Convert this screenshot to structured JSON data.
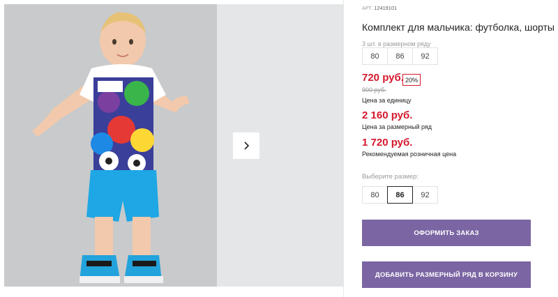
{
  "gallery": {
    "next_arrow": "›"
  },
  "product": {
    "sku_label": "АРТ.",
    "sku_value": "12419101",
    "title": "Комплект для мальчика: футболка, шорты",
    "row_note": "3 шт. в размерном ряду",
    "row_sizes": [
      "80",
      "86",
      "92"
    ],
    "price": "720 руб.",
    "discount": "20%",
    "old_price": "900 руб.",
    "price_caption": "Цена за единицу",
    "row_price": "2 160 руб.",
    "row_price_caption": "Цена за размерный ряд",
    "retail_price": "1 720 руб.",
    "retail_caption": "Рекомендуемая розничная цена",
    "choose_size_label": "Выберите размер:",
    "size_options": [
      "80",
      "86",
      "92"
    ],
    "selected_size": "86",
    "order_button": "ОФОРМИТЬ ЗАКАЗ",
    "add_row_button": "ДОБАВИТЬ РАЗМЕРНЫЙ РЯД В КОРЗИНУ"
  },
  "colors": {
    "price_red": "#d4182c",
    "button_purple": "#7b65a3"
  },
  "icons": [
    "chevron-right-icon"
  ]
}
